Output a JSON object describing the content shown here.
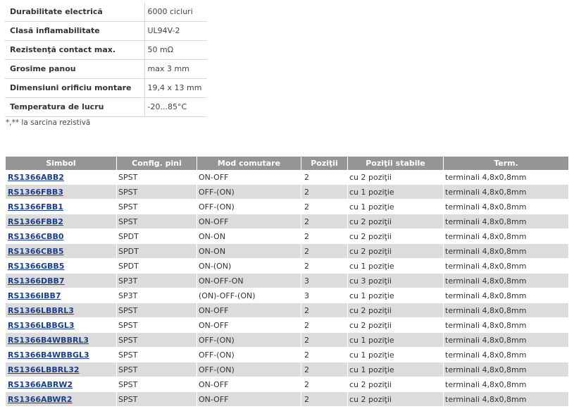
{
  "specs": [
    {
      "label": "Durabilitate electrică",
      "value": "6000 cicluri"
    },
    {
      "label": "Clasă inflamabilitate",
      "value": "UL94V-2"
    },
    {
      "label": "Rezistenţă contact max.",
      "value": "50 mΩ"
    },
    {
      "label": "Grosime panou",
      "value": "max 3 mm"
    },
    {
      "label": "Dimensiuni orificiu montare",
      "value": "19,4 x 13 mm"
    },
    {
      "label": "Temperatura de lucru",
      "value": "-20...85°C"
    }
  ],
  "footnote": "*,** la sarcina rezistivă",
  "products": {
    "headers": [
      "Simbol",
      "Config. pini",
      "Mod comutare",
      "Poziţii",
      "Poziţii stabile",
      "Term."
    ],
    "rows": [
      [
        "RS1366ABB2",
        "SPST",
        "ON-OFF",
        "2",
        "cu 2 poziţii",
        "terminali 4,8x0,8mm"
      ],
      [
        "RS1366FBB3",
        "SPST",
        "OFF-(ON)",
        "2",
        "cu 1 poziţie",
        "terminali 4,8x0,8mm"
      ],
      [
        "RS1366FBB1",
        "SPST",
        "OFF-(ON)",
        "2",
        "cu 1 poziţie",
        "terminali 4,8x0,8mm"
      ],
      [
        "RS1366FBB2",
        "SPST",
        "ON-OFF",
        "2",
        "cu 2 poziţii",
        "terminali 4,8x0,8mm"
      ],
      [
        "RS1366CBB0",
        "SPDT",
        "ON-ON",
        "2",
        "cu 2 poziţii",
        "terminali 4,8x0,8mm"
      ],
      [
        "RS1366CBB5",
        "SPDT",
        "ON-ON",
        "2",
        "cu 2 poziţii",
        "terminali 4,8x0,8mm"
      ],
      [
        "RS1366GBB5",
        "SPDT",
        "ON-(ON)",
        "2",
        "cu 1 poziţie",
        "terminali 4,8x0,8mm"
      ],
      [
        "RS1366DBB7",
        "SP3T",
        "ON-OFF-ON",
        "3",
        "cu 3 poziţii",
        "terminali 4,8x0,8mm"
      ],
      [
        "RS1366IBB7",
        "SP3T",
        "(ON)-OFF-(ON)",
        "3",
        "cu 1 poziţie",
        "terminali 4,8x0,8mm"
      ],
      [
        "RS1366LBBRL3",
        "SPST",
        "ON-OFF",
        "2",
        "cu 2 poziţii",
        "terminali 4,8x0,8mm"
      ],
      [
        "RS1366LBBGL3",
        "SPST",
        "ON-OFF",
        "2",
        "cu 2 poziţii",
        "terminali 4,8x0,8mm"
      ],
      [
        "RS1366B4WBBRL3",
        "SPST",
        "OFF-(ON)",
        "2",
        "cu 1 poziţie",
        "terminali 4,8x0,8mm"
      ],
      [
        "RS1366B4WBBGL3",
        "SPST",
        "OFF-(ON)",
        "2",
        "cu 1 poziţie",
        "terminali 4,8x0,8mm"
      ],
      [
        "RS1366LBBRL32",
        "SPST",
        "OFF-(ON)",
        "2",
        "cu 1 poziţie",
        "terminali 4,8x0,8mm"
      ],
      [
        "RS1366ABRW2",
        "SPST",
        "ON-OFF",
        "2",
        "cu 2 poziţii",
        "terminali 4,8x0,8mm"
      ],
      [
        "RS1366ABWR2",
        "SPST",
        "ON-OFF",
        "2",
        "cu 2 poziţii",
        "terminali 4,8x0,8mm"
      ]
    ]
  },
  "colors": {
    "header_bg": "#959595",
    "row_alt_bg": "#dcdcdc",
    "link": "#1a3f8f"
  }
}
